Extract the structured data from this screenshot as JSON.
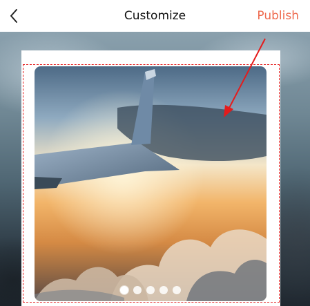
{
  "header": {
    "title": "Customize",
    "publish_label": "Publish"
  },
  "carousel": {
    "dot_count": 5,
    "active_index": 0
  },
  "colors": {
    "accent": "#ee6a4e",
    "annotation": "#e51b1b"
  },
  "icons": {
    "back": "chevron-left-icon"
  }
}
